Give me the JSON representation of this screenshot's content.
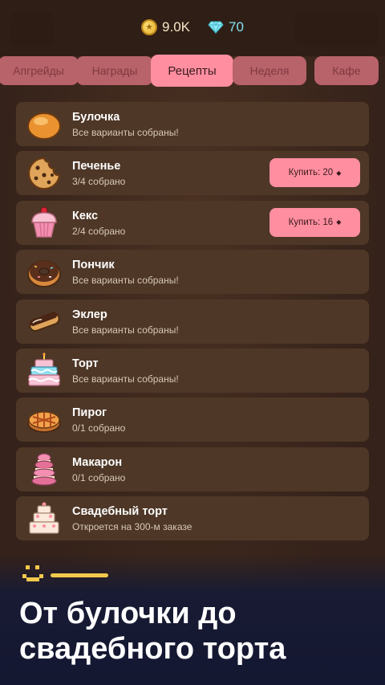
{
  "currency": {
    "coins": "9.0K",
    "gems": "70"
  },
  "tabs": [
    {
      "label": "Апгрейды",
      "active": false
    },
    {
      "label": "Награды",
      "active": false
    },
    {
      "label": "Рецепты",
      "active": true
    },
    {
      "label": "Неделя",
      "active": false
    },
    {
      "label": "Кафе",
      "active": false
    }
  ],
  "recipes": [
    {
      "name": "Булочка",
      "status": "Все варианты собраны!",
      "icon": "bun-icon"
    },
    {
      "name": "Печенье",
      "status": "3/4 собрано",
      "icon": "cookie-icon",
      "buy": "Купить: 20"
    },
    {
      "name": "Кекс",
      "status": "2/4 собрано",
      "icon": "cupcake-icon",
      "buy": "Купить: 16"
    },
    {
      "name": "Пончик",
      "status": "Все варианты собраны!",
      "icon": "donut-icon"
    },
    {
      "name": "Эклер",
      "status": "Все варианты собраны!",
      "icon": "eclair-icon"
    },
    {
      "name": "Торт",
      "status": "Все варианты собраны!",
      "icon": "cake-icon"
    },
    {
      "name": "Пирог",
      "status": "0/1 собрано",
      "icon": "pie-icon"
    },
    {
      "name": "Макарон",
      "status": "0/1 собрано",
      "icon": "macaron-icon"
    },
    {
      "name": "Свадебный торт",
      "status": "Откроется на 300-м заказе",
      "icon": "wedding-cake-icon"
    }
  ],
  "banner": {
    "line1": "От булочки до",
    "line2": "свадебного торта"
  },
  "colors": {
    "accent": "#ff8ea0",
    "row_bg": "#4e3727",
    "banner_bg": "#141731",
    "highlight": "#f2c94c"
  }
}
